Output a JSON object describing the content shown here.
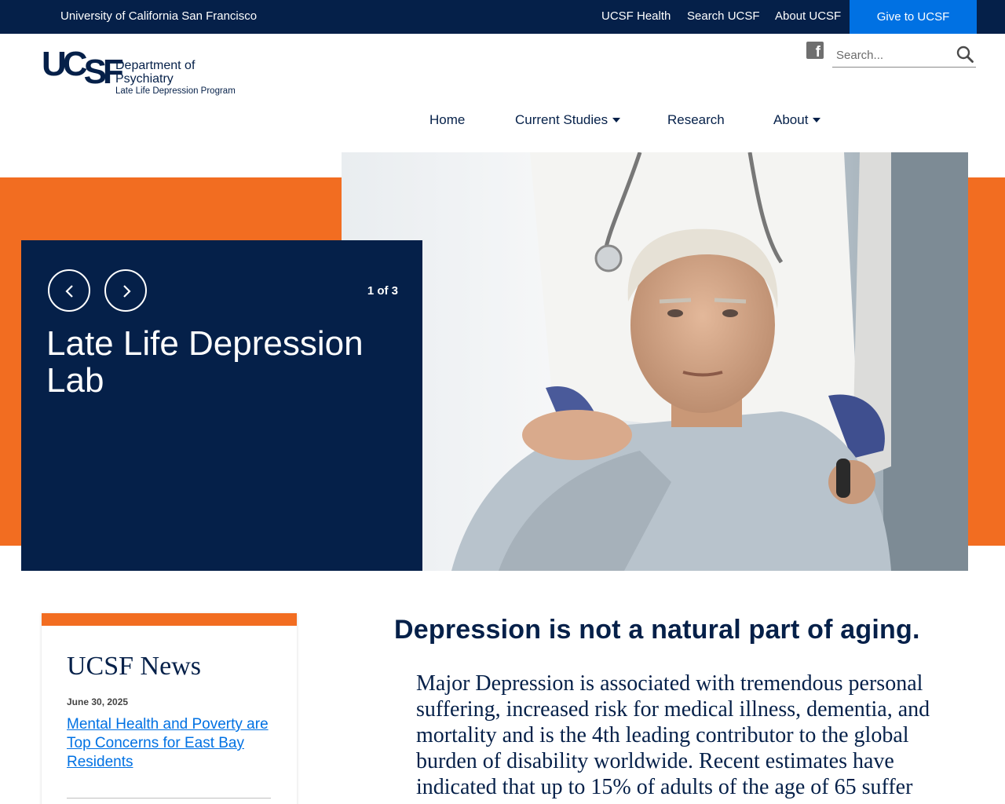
{
  "utility_bar": {
    "university": "University of California San Francisco",
    "links": [
      "UCSF Health",
      "Search UCSF",
      "About UCSF"
    ],
    "give_label": "Give to UCSF",
    "background": "#052049",
    "give_color": "#0071e3"
  },
  "header": {
    "logo_mark_uc": "UC",
    "logo_mark_sf": "SF",
    "dept_line1": "Department of",
    "dept_line2": "Psychiatry",
    "program": "Late Life Depression Program",
    "social_icon": "facebook-icon",
    "search_placeholder": "Search..."
  },
  "nav": {
    "items": [
      {
        "label": "Home",
        "has_dropdown": false
      },
      {
        "label": "Current Studies",
        "has_dropdown": true
      },
      {
        "label": "Research",
        "has_dropdown": false
      },
      {
        "label": "About",
        "has_dropdown": true
      }
    ]
  },
  "hero": {
    "slide_count": "1 of 3",
    "title": "Late Life Depression Lab",
    "prev_icon": "chevron-left-icon",
    "next_icon": "chevron-right-icon",
    "accent_color": "#f26d21",
    "panel_color": "#052049"
  },
  "news": {
    "heading": "UCSF News",
    "date": "June 30, 2025",
    "link_text": "Mental Health and Poverty are Top Concerns for East Bay Residents"
  },
  "main": {
    "headline": "Depression is not a natural part of aging.",
    "intro": "Major Depression is associated with tremendous personal suffering, increased risk for medical illness, dementia, and mortality and is the 4th leading contributor to the global burden of disability worldwide.  Recent estimates have indicated that up to 15% of adults of the age of 65 suffer"
  }
}
